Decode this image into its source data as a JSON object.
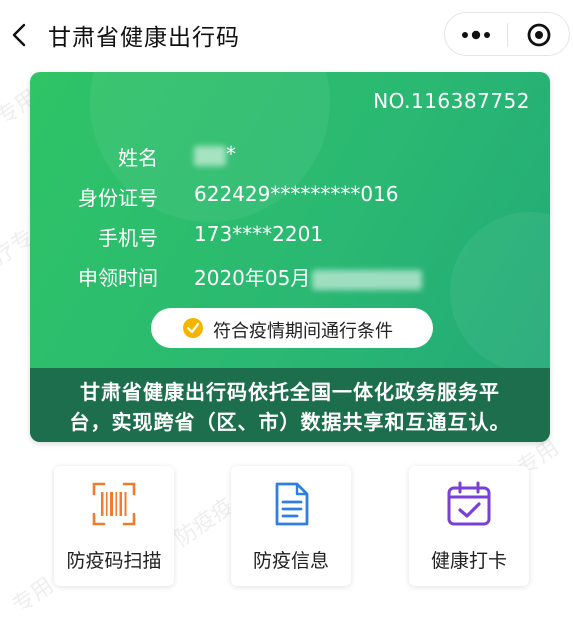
{
  "nav": {
    "title": "甘肃省健康出行码"
  },
  "card": {
    "number": "NO.116387752",
    "fields": {
      "name": {
        "label": "姓名",
        "value": "*"
      },
      "id": {
        "label": "身份证号",
        "value": "622429*********016"
      },
      "phone": {
        "label": "手机号",
        "value": "173****2201"
      },
      "date": {
        "label": "申领时间",
        "value": "2020年05月"
      }
    },
    "status": "符合疫情期间通行条件",
    "footer": {
      "line1": "甘肃省健康出行码依托全国一体化政务服务平",
      "line2": "台，实现跨省（区、市）数据共享和互通互认。"
    }
  },
  "tiles": [
    {
      "label": "防疫码扫描",
      "icon": "barcode-scan-icon",
      "color": "#f07b2c"
    },
    {
      "label": "防疫信息",
      "icon": "document-icon",
      "color": "#2f7fe0"
    },
    {
      "label": "健康打卡",
      "icon": "calendar-check-icon",
      "color": "#7a3fd6"
    }
  ],
  "colors": {
    "card_green": "#2fc466",
    "footer_green": "#1c6e4c",
    "status_check": "#f5b400"
  }
}
